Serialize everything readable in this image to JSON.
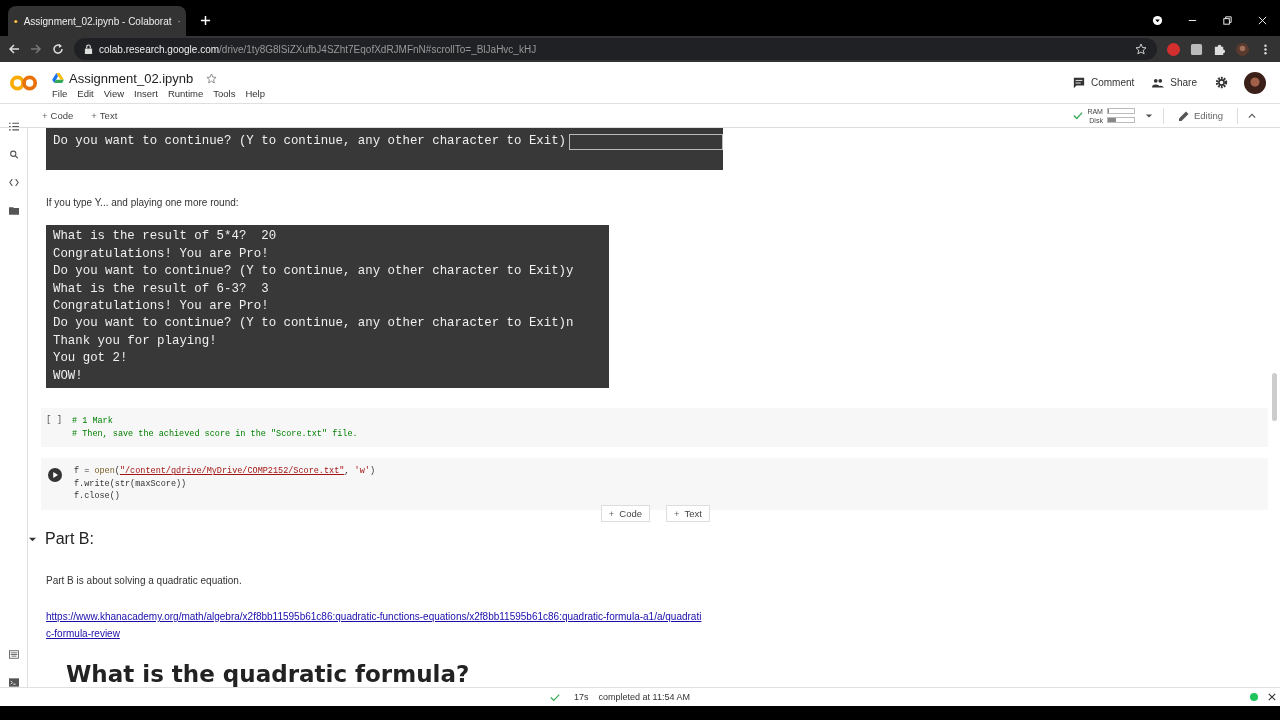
{
  "browser": {
    "tab_title": "Assignment_02.ipynb - Colaborat",
    "url_host": "colab.research.google.com",
    "url_path": "/drive/1ty8G8lSiZXufbJ4SZht7EqofXdRJMFnN#scrollTo=_BlJaHvc_kHJ"
  },
  "notebook": {
    "title": "Assignment_02.ipynb",
    "starred": false,
    "menu": [
      "File",
      "Edit",
      "View",
      "Insert",
      "Runtime",
      "Tools",
      "Help"
    ],
    "actions": [
      "Comment",
      "Share"
    ]
  },
  "toolbar": {
    "add_buttons": [
      {
        "icon": "+",
        "label": "Code"
      },
      {
        "icon": "+",
        "label": "Text"
      }
    ],
    "ram_label": "RAM",
    "ram": {
      "level": 0.06
    },
    "disk_label": "Disk",
    "disk": {
      "level": 0.3
    },
    "connected": true,
    "mode": "Editing"
  },
  "cells": [
    {
      "kind": "prompt_output",
      "lines": [
        "Do you want to continue? (Y to continue, any other character to Exit)"
      ]
    },
    {
      "kind": "text",
      "text": "If you type Y... and playing one more round:"
    },
    {
      "kind": "output",
      "lines": [
        "What is the result of 5*4?  20",
        "Congratulations! You are Pro!",
        "Do you want to continue? (Y to continue, any other character to Exit)y",
        "What is the result of 6-3?  3",
        "Congratulations! You are Pro!",
        "Do you want to continue? (Y to continue, any other character to Exit)n",
        "Thank you for playing!",
        "You got 2!",
        "WOW!"
      ]
    },
    {
      "kind": "code",
      "bracket": "[ ]",
      "lines": [
        [
          {
            "kind": "comment",
            "text": "# 1 Mark"
          }
        ],
        [
          {
            "kind": "comment",
            "text": "# Then, save the achieved score in the \"Score.txt\" file."
          }
        ]
      ]
    },
    {
      "kind": "code_run",
      "lines": [
        [
          {
            "kind": "plain",
            "text": "f = "
          },
          {
            "kind": "func",
            "text": "open"
          },
          {
            "kind": "plain",
            "text": "("
          },
          {
            "kind": "path",
            "text": "\"/content/gdrive/MyDrive/COMP2152/Score.txt\""
          },
          {
            "kind": "plain",
            "text": ", "
          },
          {
            "kind": "string",
            "text": "'w'"
          },
          {
            "kind": "plain",
            "text": ")"
          }
        ],
        [
          {
            "kind": "plain",
            "text": "f.write(str(maxScore))"
          }
        ],
        [
          {
            "kind": "plain",
            "text": "f.close()"
          }
        ]
      ],
      "add_buttons": [
        {
          "icon": "+",
          "label": "Code"
        },
        {
          "icon": "+",
          "label": "Text"
        }
      ]
    },
    {
      "kind": "section",
      "text": "Part B:",
      "expanded": true
    },
    {
      "kind": "text",
      "text": "Part B is about solving a quadratic equation."
    },
    {
      "kind": "link",
      "text": "https://www.khanacademy.org/math/algebra/x2f8bb11595b61c86:quadratic-functions-equations/x2f8bb11595b61c86:quadratic-formula-a1/a/quadratic-formula-review"
    },
    {
      "kind": "heading",
      "text": "What is the quadratic formula?"
    }
  ],
  "status": {
    "done": true,
    "duration": "17s",
    "message": "completed at 11:54 AM"
  }
}
